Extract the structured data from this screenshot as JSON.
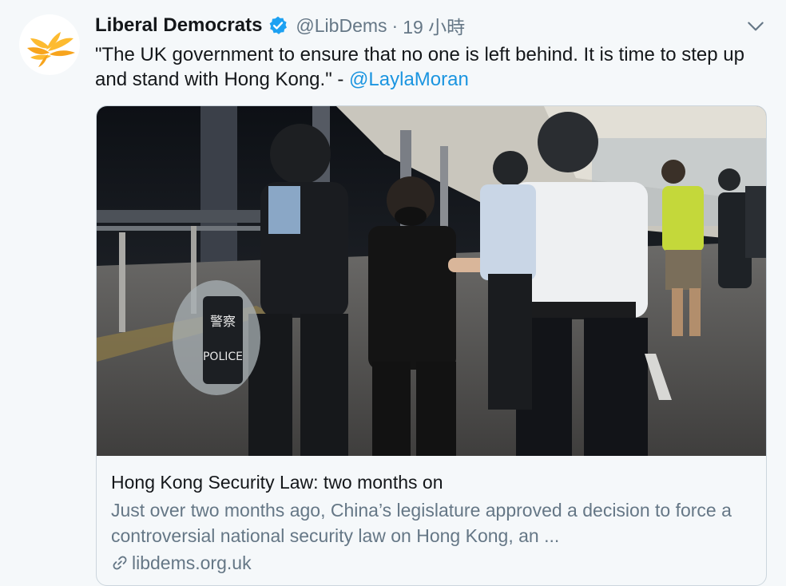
{
  "tweet": {
    "author_name": "Liberal Democrats",
    "handle": "@LibDems",
    "separator": "·",
    "time": "19 小時",
    "text": "\"The UK government to ensure that no one is left behind. It is time to step up and stand with Hong Kong.\" - ",
    "mention": "@LaylaMoran"
  },
  "card": {
    "title": "Hong Kong Security Law: two months on",
    "description": "Just over two months ago, China’s legislature approved a decision to force a controversial national security law on Hong Kong, an ...",
    "domain": "libdems.org.uk",
    "image_police_text_cn": "警察",
    "image_police_text": "POLICE"
  },
  "icons": {
    "avatar": "liberal-democrats-bird-logo",
    "verified": "verified-badge-icon",
    "menu": "chevron-down-icon",
    "link": "link-icon"
  },
  "colors": {
    "link_blue": "#1b95e0",
    "verified_blue": "#1da1f2",
    "muted_text": "#657786",
    "background": "#f5f8fa",
    "logo_gold": "#fdbb30"
  }
}
